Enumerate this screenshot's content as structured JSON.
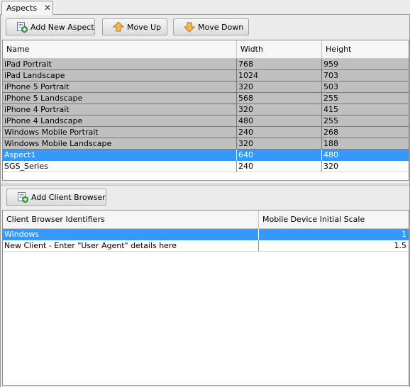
{
  "tab": {
    "label": "Aspects",
    "close": "✕"
  },
  "toolbar": {
    "add_aspect": "Add New Aspect",
    "move_up": "Move Up",
    "move_down": "Move Down"
  },
  "aspects": {
    "headers": [
      "Name",
      "Width",
      "Height"
    ],
    "rows": [
      {
        "name": "iPad Portrait",
        "width": "768",
        "height": "959",
        "style": "grey"
      },
      {
        "name": "iPad Landscape",
        "width": "1024",
        "height": "703",
        "style": "grey"
      },
      {
        "name": "iPhone 5 Portrait",
        "width": "320",
        "height": "503",
        "style": "grey"
      },
      {
        "name": "iPhone 5 Landscape",
        "width": "568",
        "height": "255",
        "style": "grey"
      },
      {
        "name": "iPhone 4 Portrait",
        "width": "320",
        "height": "415",
        "style": "grey"
      },
      {
        "name": "iPhone 4 Landscape",
        "width": "480",
        "height": "255",
        "style": "grey"
      },
      {
        "name": "Windows Mobile Portrait",
        "width": "240",
        "height": "268",
        "style": "grey"
      },
      {
        "name": "Windows Mobile Landscape",
        "width": "320",
        "height": "188",
        "style": "grey"
      },
      {
        "name": "Aspect1",
        "width": "640",
        "height": "480",
        "style": "selected"
      },
      {
        "name": "SGS_Series",
        "width": "240",
        "height": "320",
        "style": "white"
      }
    ]
  },
  "browser_toolbar": {
    "add_client": "Add Client Browser"
  },
  "browsers": {
    "headers": [
      "Client Browser Identifiers",
      "Mobile Device Initial Scale"
    ],
    "rows": [
      {
        "id": "Windows",
        "scale": "1",
        "style": "selected"
      },
      {
        "id": "New Client - Enter \"User Agent\" details here",
        "scale": "1.5",
        "style": "white"
      }
    ]
  },
  "colors": {
    "selection": "#3399ff",
    "default_row": "#c0c0c0"
  },
  "icons": {
    "add": "add-document-icon",
    "up": "arrow-up-icon",
    "down": "arrow-down-icon",
    "close": "close-icon"
  }
}
